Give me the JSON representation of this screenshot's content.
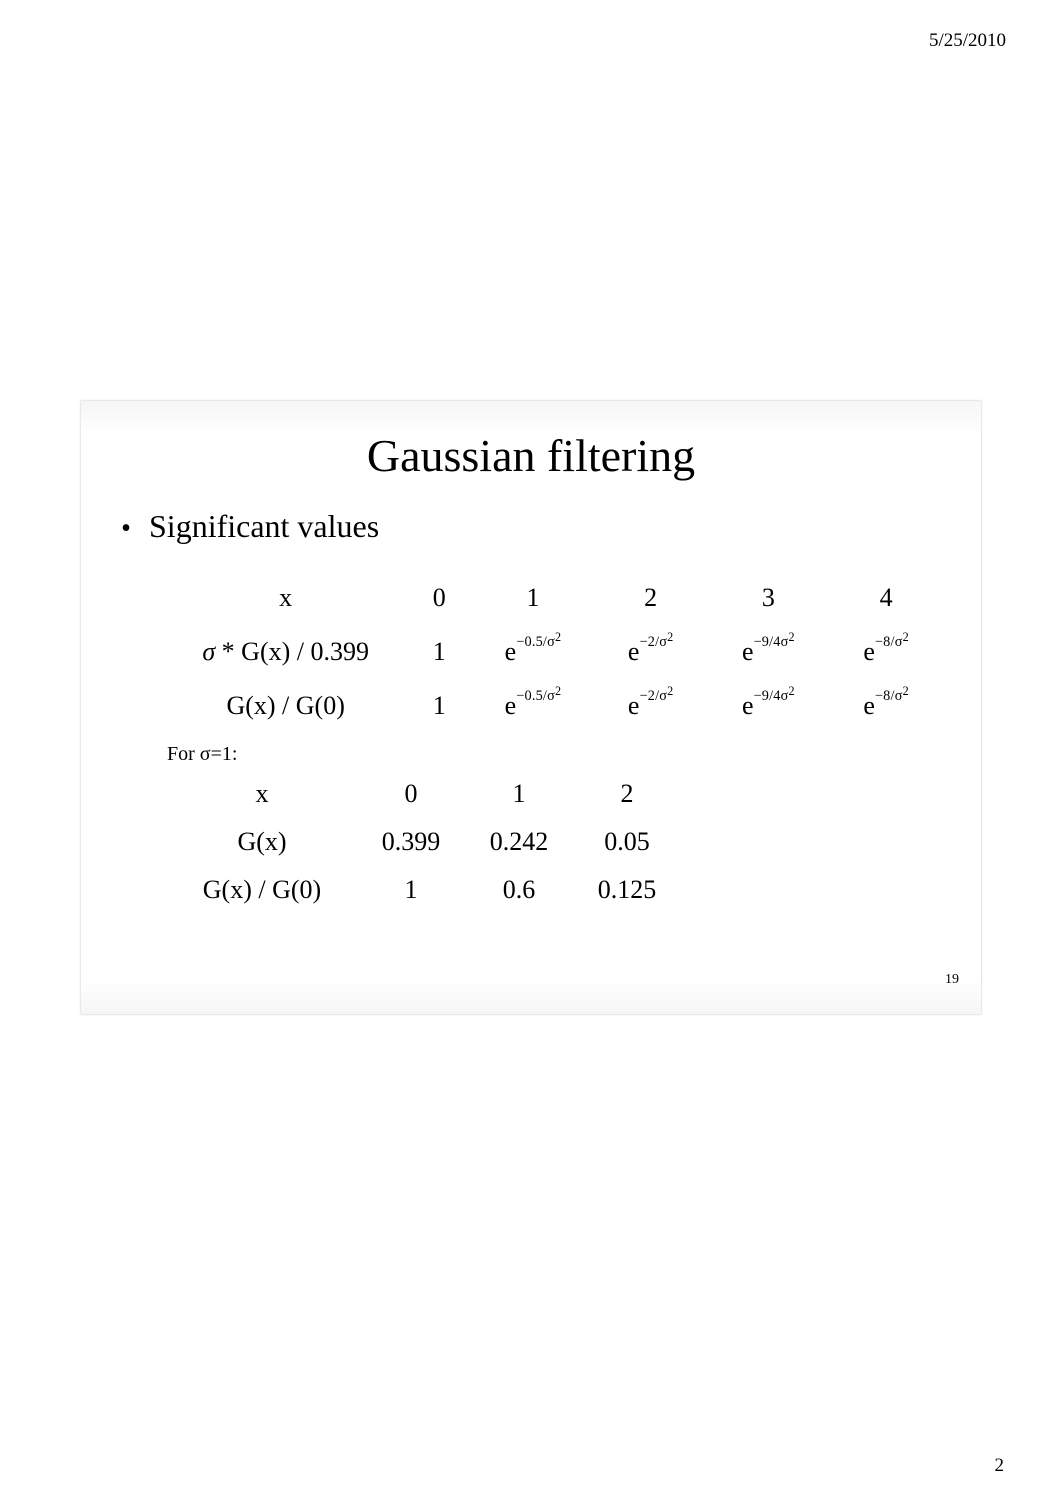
{
  "header": {
    "date": "5/25/2010"
  },
  "footer": {
    "page_number": "2"
  },
  "slide": {
    "title": "Gaussian filtering",
    "bullet": "Significant values",
    "slide_number": "19",
    "table1": {
      "row_x": {
        "label": "x",
        "c0": "0",
        "c1": "1",
        "c2": "2",
        "c3": "3",
        "c4": "4"
      },
      "row_sg": {
        "prefix": "σ",
        "star": "*",
        "func": "G(x) / 0.399",
        "c0": "1",
        "e1": "−0.5/σ",
        "e2": "−2/σ",
        "e3": "−9/4σ",
        "e4": "−8/σ"
      },
      "row_gxg0": {
        "label": "G(x) / G(0)",
        "c0": "1",
        "e1": "−0.5/σ",
        "e2": "−2/σ",
        "e3": "−9/4σ",
        "e4": "−8/σ"
      }
    },
    "for_sigma": "For σ=1:",
    "table2": {
      "row_x": {
        "label": "x",
        "c0": "0",
        "c1": "1",
        "c2": "2"
      },
      "row_gx": {
        "label": "G(x)",
        "c0": "0.399",
        "c1": "0.242",
        "c2": "0.05"
      },
      "row_gxg0": {
        "label": "G(x) / G(0)",
        "c0": "1",
        "c1": "0.6",
        "c2": "0.125"
      }
    }
  },
  "chart_data": [
    {
      "type": "table",
      "title": "Gaussian filtering — significant values",
      "columns": [
        "x",
        "0",
        "1",
        "2",
        "3",
        "4"
      ],
      "rows": [
        [
          "σ * G(x) / 0.399",
          "1",
          "e^(-0.5/σ^2)",
          "e^(-2/σ^2)",
          "e^(-9/4σ^2)",
          "e^(-8/σ^2)"
        ],
        [
          "G(x) / G(0)",
          "1",
          "e^(-0.5/σ^2)",
          "e^(-2/σ^2)",
          "e^(-9/4σ^2)",
          "e^(-8/σ^2)"
        ]
      ]
    },
    {
      "type": "table",
      "title": "For σ=1",
      "columns": [
        "x",
        "0",
        "1",
        "2"
      ],
      "rows": [
        [
          "G(x)",
          "0.399",
          "0.242",
          "0.05"
        ],
        [
          "G(x) / G(0)",
          "1",
          "0.6",
          "0.125"
        ]
      ]
    }
  ]
}
